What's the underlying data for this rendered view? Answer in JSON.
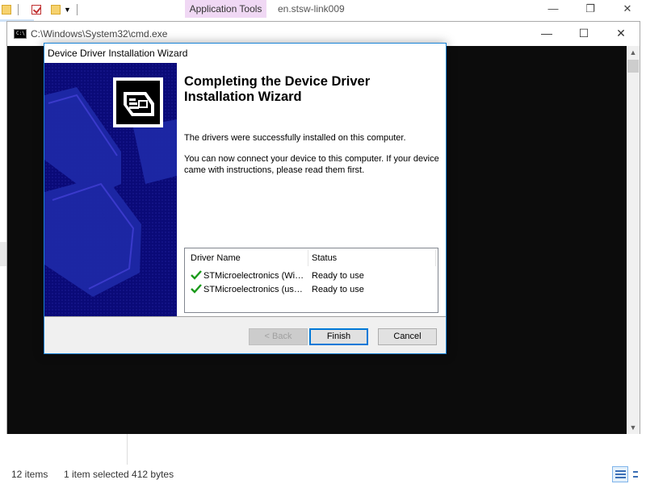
{
  "explorer": {
    "ribbon_tab": "Application Tools",
    "window_title": "en.stsw-link009",
    "controls": {
      "minimize": "—",
      "maximize": "❐",
      "close": "✕"
    },
    "status": {
      "items": "12 items",
      "selected": "1 item selected  412 bytes"
    }
  },
  "cmd": {
    "title": "C:\\Windows\\System32\\cmd.exe",
    "icon_text": "C:\\",
    "controls": {
      "minimize": "—",
      "maximize": "☐",
      "close": "✕"
    },
    "scroll_up": "▲",
    "scroll_down": "▼"
  },
  "wizard": {
    "title": "Device Driver Installation Wizard",
    "heading": "Completing the Device Driver Installation Wizard",
    "text1": "The drivers were successfully installed on this computer.",
    "text2": "You can now connect your device to this computer. If your device came with instructions, please read them first.",
    "table": {
      "headers": {
        "name": "Driver Name",
        "status": "Status"
      },
      "rows": [
        {
          "name": "STMicroelectronics (WinUSB)",
          "status": "Ready to use"
        },
        {
          "name": "STMicroelectronics (usbser)",
          "status": "Ready to use"
        }
      ]
    },
    "buttons": {
      "back": "< Back",
      "finish": "Finish",
      "cancel": "Cancel"
    }
  },
  "colors": {
    "banner": "#0a0a78",
    "accent": "#0078d7",
    "check": "#1a9a1a"
  }
}
